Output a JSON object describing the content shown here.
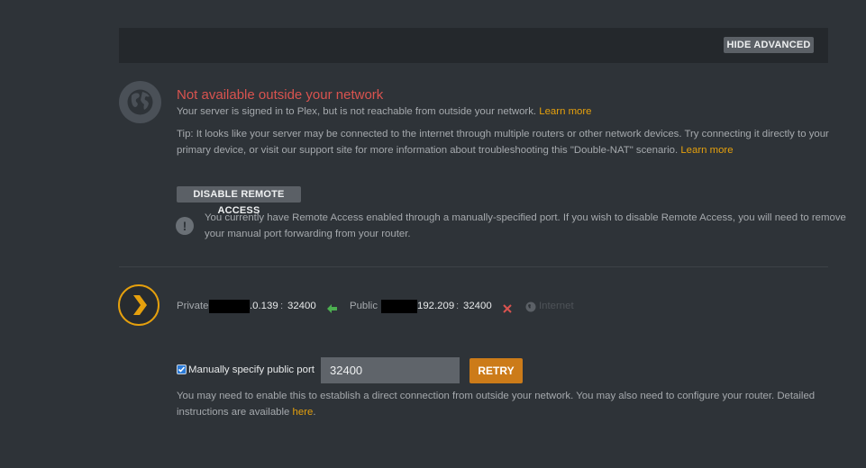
{
  "header": {
    "hide_advanced_label": "HIDE ADVANCED"
  },
  "status": {
    "title": "Not available outside your network",
    "message": "Your server is signed in to Plex, but is not reachable from outside your network.",
    "message_link": "Learn more",
    "tip_line1": "Tip: It looks like your server may be connected to the internet through multiple routers or other network devices. Try connecting it directly to your",
    "tip_line2": "primary device, or visit our support site for more information about troubleshooting this \"Double-NAT\" scenario.",
    "tip_link": "Learn more"
  },
  "remote_access": {
    "disable_label": "DISABLE REMOTE ACCESS",
    "notice_line1": "You currently have Remote Access enabled through a manually-specified port. If you wish to disable Remote Access, you will need to remove",
    "notice_line2": "your manual port forwarding from your router."
  },
  "connection": {
    "private_label": "Private",
    "private_ip_suffix": ".0.139",
    "private_sep": ":",
    "private_port": "32400",
    "public_label": "Public",
    "public_ip_suffix": "192.209",
    "public_sep": ":",
    "public_port": "32400",
    "internet_label": "Internet"
  },
  "manual_port": {
    "checkbox_label": "Manually specify public port",
    "checked": true,
    "port_value": "32400",
    "retry_label": "RETRY",
    "help_line1": "You may need to enable this to establish a direct connection from outside your network. You may also need to configure your router. Detailed",
    "help_line2_prefix": "instructions are available",
    "help_link": "here",
    "help_suffix": "."
  },
  "colors": {
    "background": "#2e3338",
    "error": "#d9534f",
    "accent": "#e5a00d",
    "retry": "#cc7b19",
    "arrow_ok": "#4caf50",
    "x_fail": "#d9534f"
  },
  "icons": [
    "globe-icon",
    "warning-icon",
    "plex-chevron-icon",
    "arrow-left-icon",
    "x-icon",
    "internet-globe-icon",
    "checkbox-checked-icon"
  ]
}
